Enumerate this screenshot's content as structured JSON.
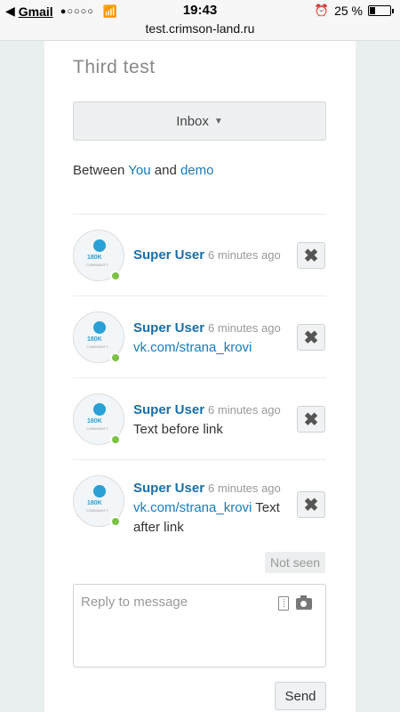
{
  "status_bar": {
    "back_glyph": "◀",
    "app": "Gmail",
    "signal": "●○○○○",
    "wifi_glyph": "📶",
    "time": "19:43",
    "alarm_glyph": "⏰",
    "battery": "25 %",
    "battery_level": 0.25
  },
  "url": "test.crimson-land.ru",
  "page": {
    "title": "Third test",
    "inbox_label": "Inbox",
    "between_prefix": "Between",
    "participant_you": "You",
    "between_and": "and",
    "participant_other": "demo"
  },
  "messages": [
    {
      "author": "Super User",
      "time": "6 minutes ago",
      "link": "",
      "text": ""
    },
    {
      "author": "Super User",
      "time": "6 minutes ago",
      "link": "vk.com/strana_krovi",
      "text": ""
    },
    {
      "author": "Super User",
      "time": "6 minutes ago",
      "link": "",
      "text": "Text before link"
    },
    {
      "author": "Super User",
      "time": "6 minutes ago",
      "link": "vk.com/strana_krovi",
      "text": "Text after link"
    }
  ],
  "avatar": {
    "count": "180K",
    "sub": "COMMUNITY"
  },
  "delete_glyph": "✖",
  "status": "Not seen",
  "reply": {
    "placeholder": "Reply to message"
  },
  "send_label": "Send",
  "colors": {
    "link": "#1a7ab8",
    "author": "#1a6fa5",
    "online": "#7cc244"
  }
}
